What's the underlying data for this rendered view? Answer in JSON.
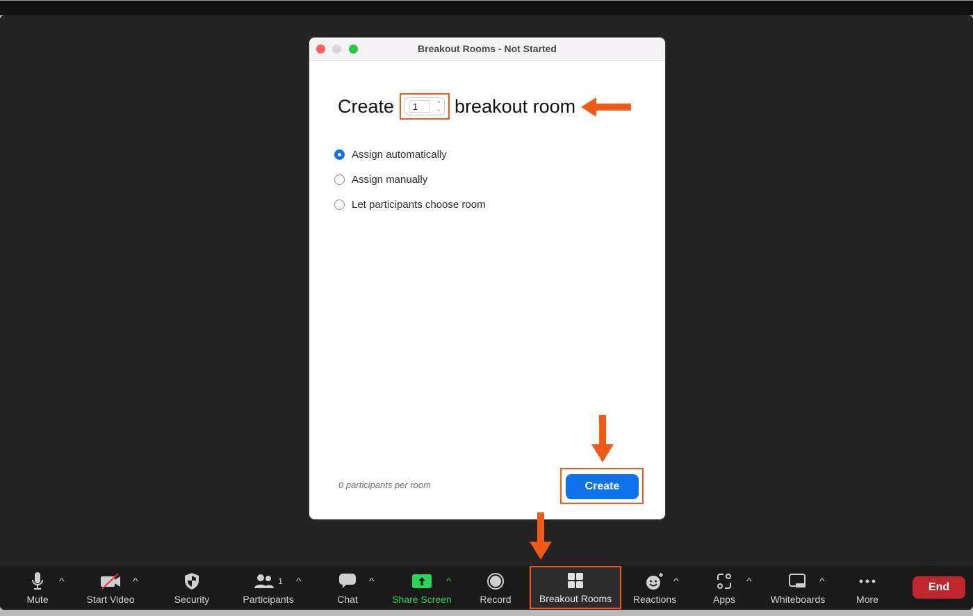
{
  "dialog": {
    "title": "Breakout Rooms - Not Started",
    "create_prefix": "Create",
    "room_count": "1",
    "create_suffix": "breakout room",
    "options": [
      {
        "label": "Assign automatically",
        "checked": true
      },
      {
        "label": "Assign manually",
        "checked": false
      },
      {
        "label": "Let participants choose room",
        "checked": false
      }
    ],
    "footnote": "0 participants per room",
    "create_button": "Create"
  },
  "toolbar": {
    "mute": "Mute",
    "start_video": "Start Video",
    "security": "Security",
    "participants": "Participants",
    "participant_count": "1",
    "chat": "Chat",
    "share_screen": "Share Screen",
    "record": "Record",
    "breakout_rooms": "Breakout Rooms",
    "reactions": "Reactions",
    "apps": "Apps",
    "whiteboards": "Whiteboards",
    "more": "More",
    "end": "End"
  },
  "colors": {
    "accent_blue": "#0e72ed",
    "annotation_orange": "#f05a14",
    "share_green": "#23d959",
    "end_red": "#c0272d"
  }
}
